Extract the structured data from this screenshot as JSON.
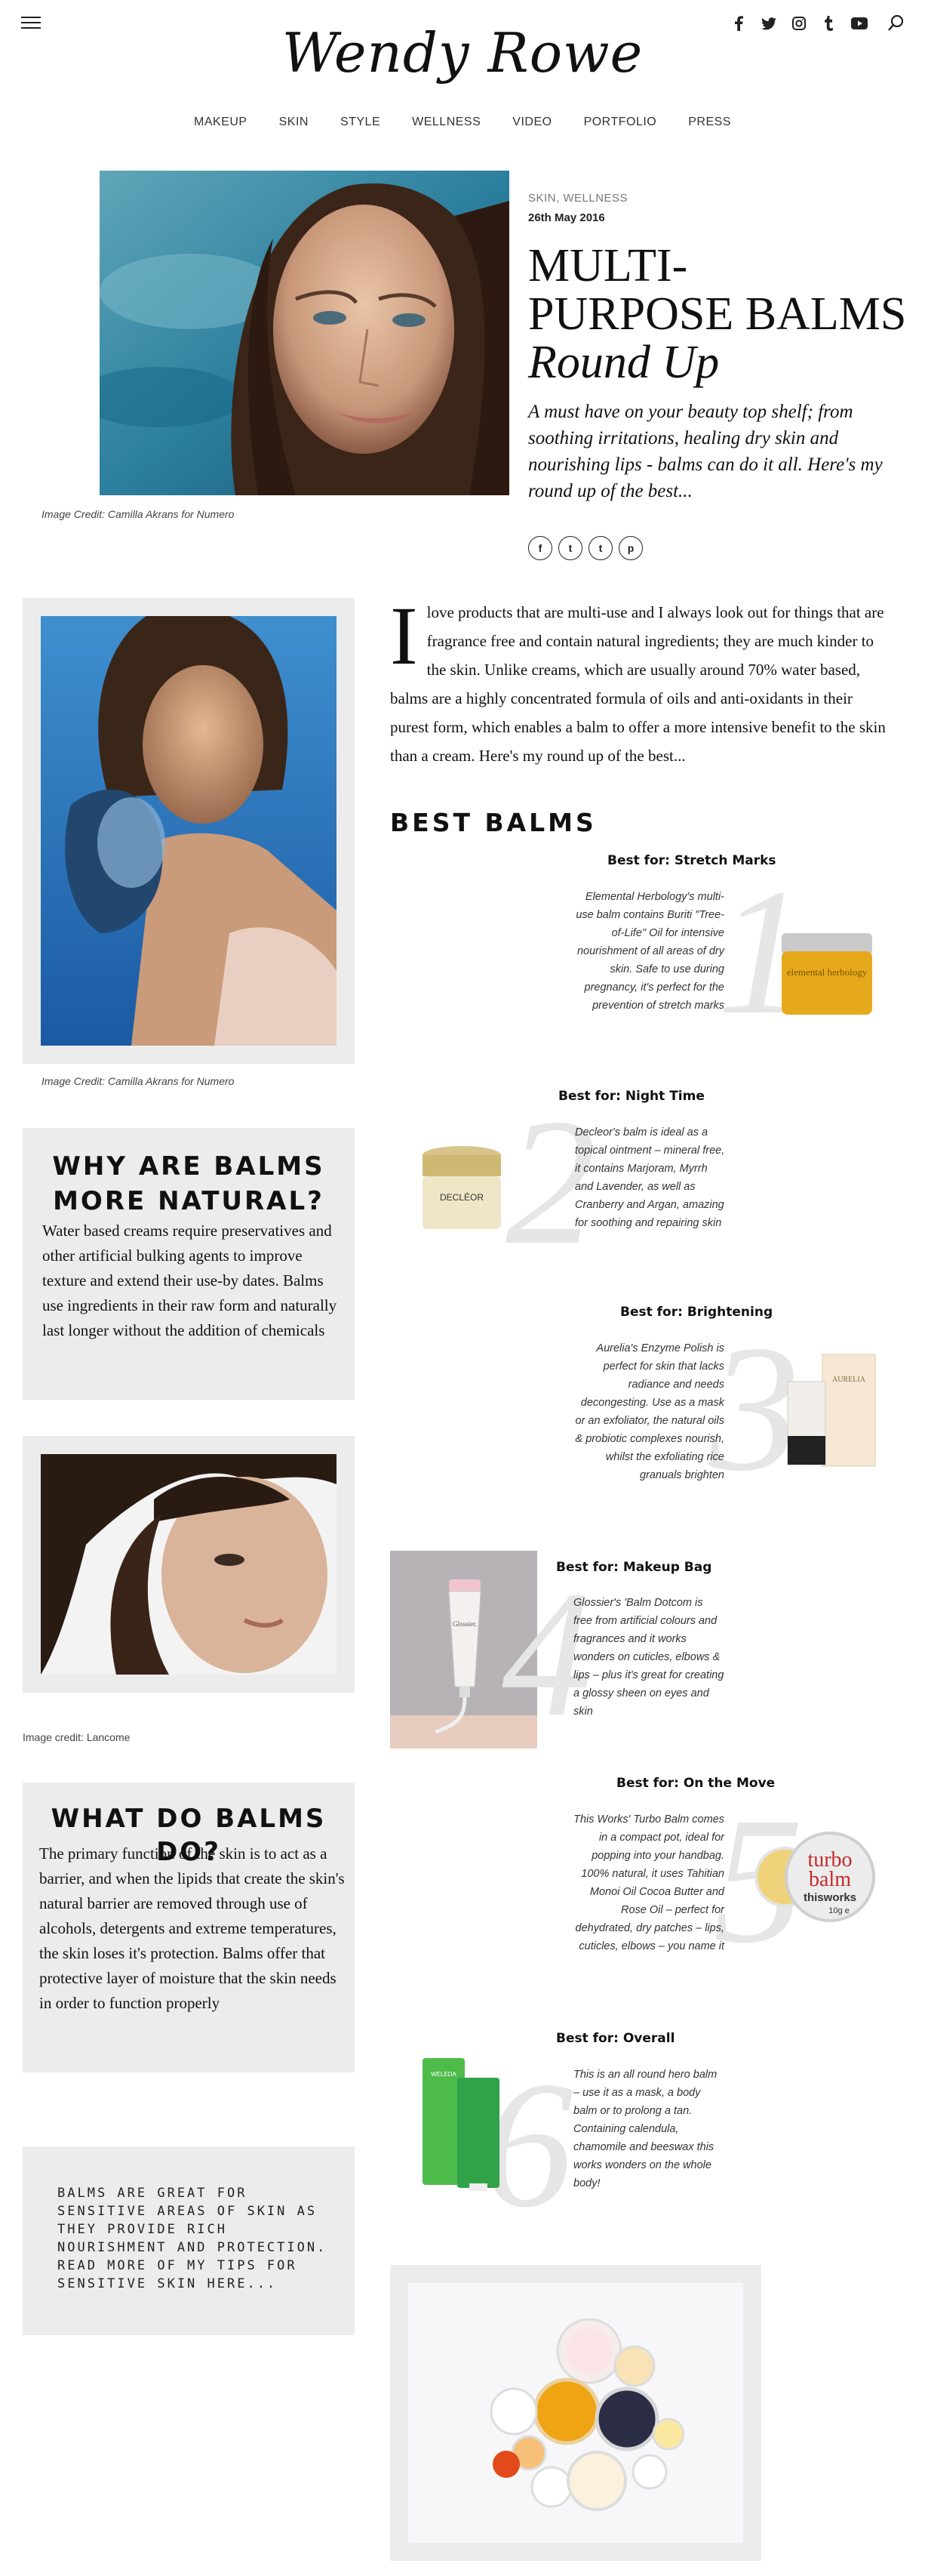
{
  "site": {
    "logo": "Wendy Rowe",
    "nav": [
      "MAKEUP",
      "SKIN",
      "STYLE",
      "WELLNESS",
      "VIDEO",
      "PORTFOLIO",
      "PRESS"
    ],
    "social_icons": [
      "facebook-icon",
      "twitter-icon",
      "instagram-icon",
      "tumblr-icon",
      "youtube-icon"
    ]
  },
  "article": {
    "categories": "SKIN, WELLNESS",
    "date": "26th May 2016",
    "title_line1": "MULTI-",
    "title_line2": "PURPOSE BALMS",
    "title_line3": "Round Up",
    "standfirst": "A must have on your beauty top shelf; from soothing irritations, healing dry skin and nourishing lips - balms can do it all. Here's my round up of the best...",
    "hero_caption": "Image Credit: Camilla Akrans for Numero",
    "share_icons": [
      "f",
      "t",
      "t",
      "p"
    ],
    "dropcap": "I",
    "intro": "love products that are multi-use and I always look out for things that are fragrance free and contain natural ingredients; they are much kinder to the skin. Unlike creams, which are usually around 70% water based, balms are a highly concentrated formula of oils and anti-oxidants in their purest form, which enables a balm to offer a more intensive benefit to the skin than a cream. Here's my round up of the best...",
    "section_heading": "BEST BALMS"
  },
  "sidebar": {
    "image1_caption": "Image Credit: Camilla Akrans for Numero",
    "box1_title": "WHY ARE BALMS MORE NATURAL?",
    "box1_body": "Water based creams require preservatives and other artificial bulking agents to improve texture and extend their use-by dates. Balms use ingredients in their raw form and naturally last longer without the addition of chemicals",
    "image2_caption": "Image credit: Lancome",
    "box2_title": "WHAT DO BALMS DO?",
    "box2_body": "The primary function of the skin is to act as a barrier, and when the lipids that create the skin's natural barrier are removed through use of  alcohols, detergents and extreme  temperatures, the skin loses it's protection. Balms offer that protective layer of moisture that the skin needs in order to function properly",
    "box3_link": "BALMS ARE GREAT FOR SENSITIVE AREAS OF SKIN AS THEY PROVIDE RICH NOURISHMENT AND PROTECTION. READ MORE OF MY TIPS FOR SENSITIVE SKIN HERE..."
  },
  "balms": [
    {
      "num": "1",
      "title": "Best for: Stretch Marks",
      "text": "Elemental Herbology's multi-use balm contains Buriti \"Tree-of-Life\" Oil for intensive nourishment of all areas of dry skin. Safe to use during pregnancy, it's perfect for the prevention of stretch marks",
      "product_label": "elemental herbology"
    },
    {
      "num": "2",
      "title": "Best for: Night Time",
      "text": "Decleor's balm is ideal as a topical ointment – mineral free, it contains Marjoram, Myrrh and Lavender, as well as Cranberry and Argan, amazing for soothing and repairing skin",
      "product_label": "DECLÉOR"
    },
    {
      "num": "3",
      "title": "Best for: Brightening",
      "text": "Aurelia's Enzyme Polish is perfect for skin that lacks radiance and needs decongesting. Use as a mask or an exfoliator, the natural oils & probiotic complexes nourish, whilst the exfoliating rice granuals brighten",
      "product_label": "AURELIA"
    },
    {
      "num": "4",
      "title": "Best for: Makeup Bag",
      "text": "Glossier's 'Balm Dotcom is free from artificial colours and fragrances and it works wonders on cuticles, elbows & lips – plus it's great for creating a glossy sheen on eyes and skin",
      "product_label": "Glossier."
    },
    {
      "num": "5",
      "title": "Best for: On the Move",
      "text": "This Works' Turbo Balm comes in a compact pot, ideal for popping into your handbag. 100% natural, it uses Tahitian Monoi Oil Cocoa Butter and Rose Oil – perfect for dehydrated, dry patches – lips, cuticles, elbows – you name it",
      "product_label_1": "turbo",
      "product_label_2": "balm",
      "product_label_3": "thisworks",
      "product_label_4": "10g e"
    },
    {
      "num": "6",
      "title": "Best for: Overall",
      "text": "This is an all round hero balm – use it as a mask, a body balm or to prolong a tan. Containing calendula, chamomile and beeswax this works wonders on the whole body!",
      "product_label": "WELEDA"
    }
  ],
  "colors": {
    "box_grey": "#ececec",
    "big_number": "#e6e6e6",
    "text": "#111111"
  }
}
